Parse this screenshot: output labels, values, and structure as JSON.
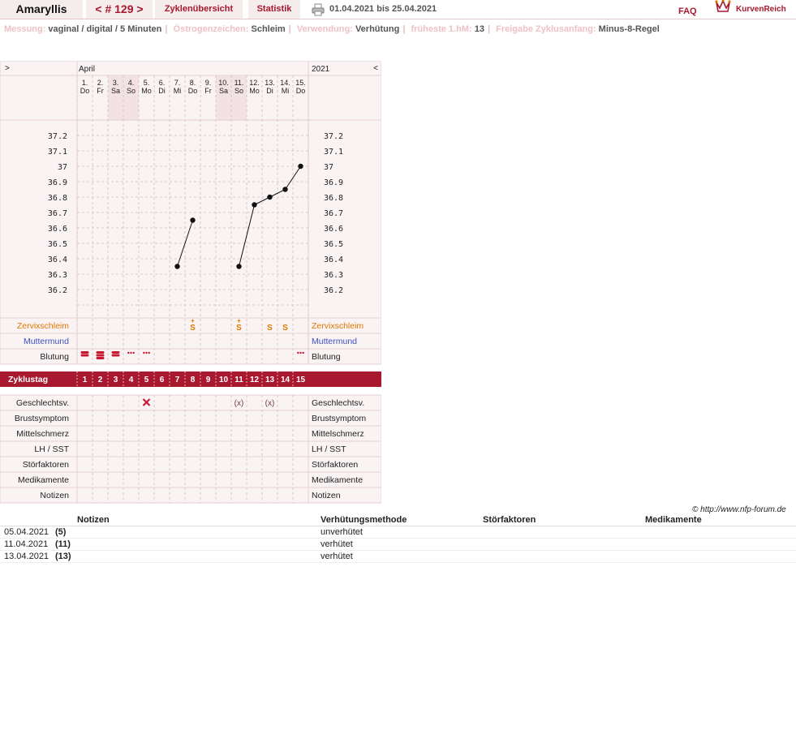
{
  "header": {
    "cycle_name": "Amaryllis",
    "cycle_number": "< # 129 >",
    "overview_label": "Zyklenübersicht",
    "statistics_label": "Statistik",
    "date_range": "01.04.2021 bis 25.04.2021",
    "faq_label": "FAQ",
    "brand": "KurvenReich"
  },
  "settings": [
    {
      "label": "Messung:",
      "value": "vaginal / digital / 5 Minuten"
    },
    {
      "label": "Östrogenzeichen:",
      "value": "Schleim"
    },
    {
      "label": "Verwendung:",
      "value": "Verhütung"
    },
    {
      "label": "früheste 1.hM:",
      "value": "13"
    },
    {
      "label": "Freigabe Zyklusanfang:",
      "value": "Minus-8-Regel"
    }
  ],
  "chart_data": {
    "type": "line",
    "month": "April",
    "year": "2021",
    "nav_prev": ">",
    "nav_next": "<",
    "days": [
      {
        "date": "1.",
        "weekday": "Do",
        "weekend": false
      },
      {
        "date": "2.",
        "weekday": "Fr",
        "weekend": false
      },
      {
        "date": "3.",
        "weekday": "Sa",
        "weekend": true
      },
      {
        "date": "4.",
        "weekday": "So",
        "weekend": true
      },
      {
        "date": "5.",
        "weekday": "Mo",
        "weekend": false
      },
      {
        "date": "6.",
        "weekday": "Di",
        "weekend": false
      },
      {
        "date": "7.",
        "weekday": "Mi",
        "weekend": false
      },
      {
        "date": "8.",
        "weekday": "Do",
        "weekend": false
      },
      {
        "date": "9.",
        "weekday": "Fr",
        "weekend": false
      },
      {
        "date": "10.",
        "weekday": "Sa",
        "weekend": true
      },
      {
        "date": "11.",
        "weekday": "So",
        "weekend": true
      },
      {
        "date": "12.",
        "weekday": "Mo",
        "weekend": false
      },
      {
        "date": "13.",
        "weekday": "Di",
        "weekend": false
      },
      {
        "date": "14.",
        "weekday": "Mi",
        "weekend": false
      },
      {
        "date": "15.",
        "weekday": "Do",
        "weekend": false
      }
    ],
    "y_ticks": [
      "37.2",
      "37.1",
      "37",
      "36.9",
      "36.8",
      "36.7",
      "36.6",
      "36.5",
      "36.4",
      "36.3",
      "36.2"
    ],
    "ylim": [
      36.2,
      37.2
    ],
    "temperatures": [
      null,
      null,
      null,
      null,
      null,
      null,
      36.35,
      36.65,
      null,
      null,
      36.35,
      36.75,
      36.8,
      36.85,
      37.0
    ],
    "segments": [
      [
        7,
        8
      ],
      [
        11,
        15
      ]
    ],
    "zervix": [
      "",
      "",
      "",
      "",
      "",
      "",
      "",
      "S+",
      "",
      "",
      "S+",
      "",
      "S",
      "S",
      ""
    ],
    "bleeding": [
      "heavy",
      "very-heavy",
      "heavy",
      "spotting",
      "spotting",
      "",
      "",
      "",
      "",
      "",
      "",
      "",
      "",
      "",
      "spotting"
    ],
    "cycle_days": [
      "1",
      "2",
      "3",
      "4",
      "5",
      "6",
      "7",
      "8",
      "9",
      "10",
      "11",
      "12",
      "13",
      "14",
      "15"
    ],
    "intercourse": [
      "",
      "",
      "",
      "",
      "x",
      "",
      "",
      "",
      "",
      "",
      "(x)",
      "",
      "(x)",
      "",
      ""
    ],
    "row_labels": {
      "zervix": "Zervixschleim",
      "muttermund": "Muttermund",
      "blutung": "Blutung",
      "zyklustag": "Zyklustag",
      "gv": "Geschlechtsv.",
      "brust": "Brustsymptom",
      "mittel": "Mittelschmerz",
      "lh": "LH / SST",
      "stoer": "Störfaktoren",
      "med": "Medikamente",
      "notizen": "Notizen"
    },
    "colors": {
      "accent": "#a8182e",
      "zervix": "#e07800",
      "muttermund": "#4050c0",
      "bleeding": "#c8182e",
      "panel": "#faf3f3",
      "weekend": "#f3e2e4"
    }
  },
  "copyright": "© http://www.nfp-forum.de",
  "notes_table": {
    "headers": {
      "notizen": "Notizen",
      "methode": "Verhütungsmethode",
      "stoer": "Störfaktoren",
      "med": "Medikamente"
    },
    "rows": [
      {
        "date": "05.04.2021",
        "day": "(5)",
        "method": "unverhütet"
      },
      {
        "date": "11.04.2021",
        "day": "(11)",
        "method": "verhütet"
      },
      {
        "date": "13.04.2021",
        "day": "(13)",
        "method": "verhütet"
      }
    ]
  }
}
